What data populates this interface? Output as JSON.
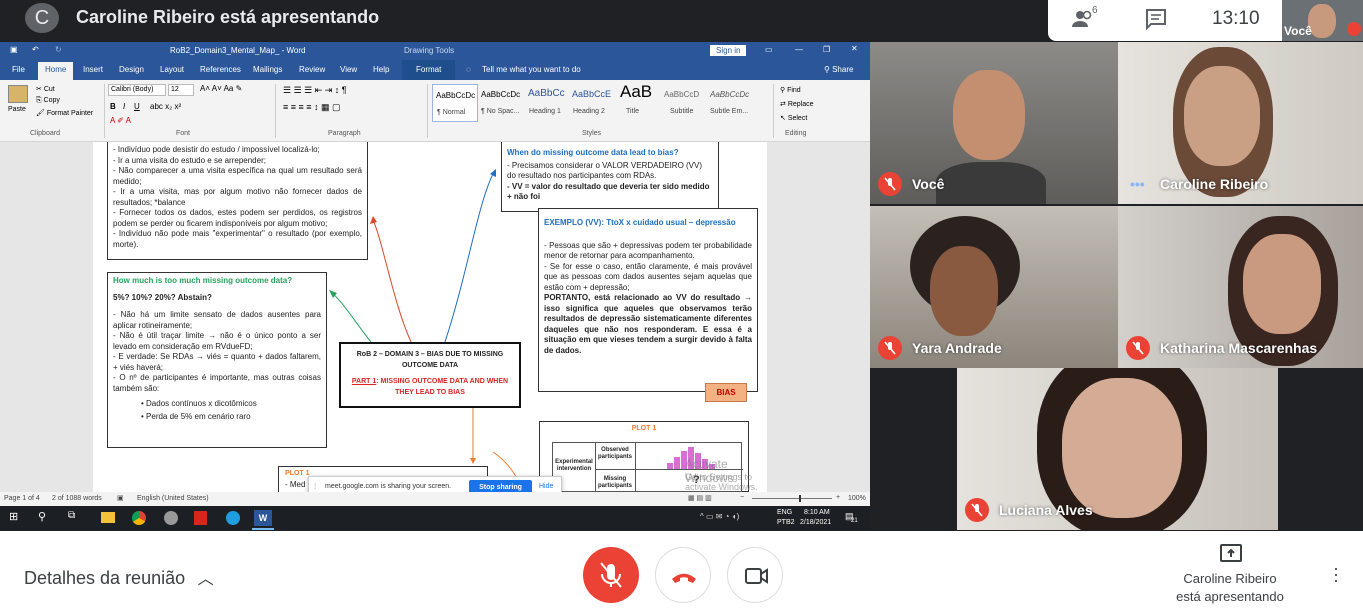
{
  "meet": {
    "avatar_letter": "C",
    "presenting_title": "Caroline Ribeiro está apresentando",
    "people_count": "6",
    "clock": "13:10",
    "self_label": "Você",
    "participants": [
      {
        "name": "Você"
      },
      {
        "name": "Caroline Ribeiro"
      },
      {
        "name": "Yara Andrade"
      },
      {
        "name": "Katharina Mascarenhas"
      },
      {
        "name": "Luciana Alves"
      }
    ],
    "bottom": {
      "details_label": "Detalhes da reunião",
      "presenter_line1": "Caroline Ribeiro",
      "presenter_line2": "está apresentando"
    },
    "colors": {
      "end_call": "#ea4335",
      "mic_off": "#ea4335",
      "bar_bg": "#202124"
    }
  },
  "word": {
    "title": "RoB2_Domain3_Mental_Map_ - Word",
    "drawing_tools": "Drawing Tools",
    "sign_in": "Sign in",
    "tabs": [
      "File",
      "Home",
      "Insert",
      "Design",
      "Layout",
      "References",
      "Mailings",
      "Review",
      "View",
      "Help",
      "Format"
    ],
    "tell_me": "Tell me what you want to do",
    "share": "Share",
    "clipboard": {
      "paste": "Paste",
      "cut": "Cut",
      "copy": "Copy",
      "format_painter": "Format Painter",
      "group": "Clipboard"
    },
    "font": {
      "name": "Calibri (Body)",
      "size": "12",
      "group": "Font"
    },
    "paragraph_group": "Paragraph",
    "styles": [
      {
        "preview": "AaBbCcDc",
        "name": "¶ Normal"
      },
      {
        "preview": "AaBbCcDc",
        "name": "¶ No Spac..."
      },
      {
        "preview": "AaBbCc",
        "name": "Heading 1"
      },
      {
        "preview": "AaBbCcE",
        "name": "Heading 2"
      },
      {
        "preview": "AaB",
        "name": "Title"
      },
      {
        "preview": "AaBbCcD",
        "name": "Subtitle"
      },
      {
        "preview": "AaBbCcDc",
        "name": "Subtle Em..."
      }
    ],
    "styles_group": "Styles",
    "editing": {
      "find": "Find",
      "replace": "Replace",
      "select": "Select",
      "group": "Editing"
    },
    "status": {
      "page": "Page 1 of 4",
      "words": "2 of 1088 words",
      "lang": "English (United States)",
      "zoom": "100%"
    },
    "share_bar": {
      "text": "meet.google.com is sharing your screen.",
      "stop": "Stop sharing",
      "hide": "Hide"
    },
    "watermark1": "Activate Windows",
    "watermark2": "Go to Settings to activate Windows.",
    "taskbar": {
      "lang1": "ENG",
      "lang2": "PTB2",
      "time": "8:10 AM",
      "date": "2/18/2021",
      "notif": "21"
    },
    "doc": {
      "box_top": [
        "- Indivíduo pode desistir do estudo / impossível localizá-lo;",
        "- Ir a uma visita do estudo e se arrepender;",
        "- Não comparecer a uma visita específica na qual um resultado será medido;",
        "- Ir a uma visita, mas por algum motivo não fornecer dados de resultados; *balance",
        "- Fornecer todos os dados, estes podem ser perdidos, os registros podem se perder ou ficarem indisponíveis por algum motivo;",
        "- Indivíduo não pode mais \"experimentar\" o resultado (por exemplo, morte)."
      ],
      "how_much_title": "How much is too much missing outcome data?",
      "how_much_sub": "5%? 10%? 20%? Abstain?",
      "how_much_lines": [
        "- Não há um limite sensato de dados ausentes para aplicar rotineiramente;",
        "- Não é útil traçar limite → não é o único ponto a ser levado em consideração em RVdueFD;",
        "- E verdade: Se RDAs → viés = quanto + dados faltarem, + viés haverá;",
        "- O nº de participantes é importante, mas outras coisas também são:"
      ],
      "how_much_bullets": [
        "Dados contínuos x dicotômicos",
        "Perda de 5% em cenário raro"
      ],
      "center_title": "RoB 2 – DOMAIN 3 – BIAS DUE TO MISSING OUTCOME DATA",
      "center_part": "PART 1",
      "center_part_rest": ": MISSING OUTCOME DATA AND WHEN THEY LEAD TO BIAS",
      "when_title": "When do missing outcome data lead to bias?",
      "when_lines": [
        "- Precisamos considerar o VALOR VERDADEIRO (VV) do resultado nos participantes com RDAs.",
        "- VV = valor do resultado que deveria ter sido medido + não foi"
      ],
      "ex_title": "EXEMPLO (VV): TtoX x cuidado usual – depressão",
      "ex_lines": [
        "- Pessoas que são + depressivas podem ter probabilidade menor de retornar para acompanhamento.",
        "- Se for esse o caso, então claramente, é mais provável que as pessoas com dados ausentes sejam aquelas que estão com + depressão;",
        "PORTANTO, está relacionado ao VV do resultado → isso significa que aqueles que observamos terão resultados de depressão sistematicamente diferentes daqueles que não nos responderam. E essa é a situação em que vieses tendem a surgir devido à falta de dados."
      ],
      "bias_label": "BIAS",
      "plot1_title": "PLOT 1",
      "plot1_rows": [
        "Experimental intervention"
      ],
      "plot1_cols": [
        "Observed participants",
        "Missing participants"
      ],
      "plot1_q": "?",
      "plot_small": "PLOT 1",
      "plot_small_line": "- Med"
    }
  }
}
